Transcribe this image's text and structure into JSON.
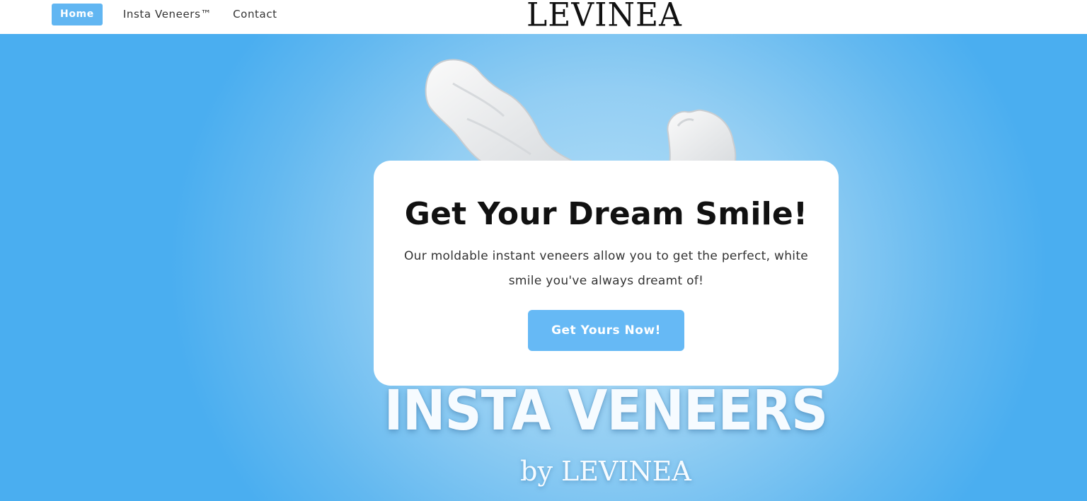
{
  "header": {
    "nav": [
      {
        "label": "Home",
        "active": true
      },
      {
        "label": "Insta Veneers™",
        "active": false
      },
      {
        "label": "Contact",
        "active": false
      }
    ],
    "logo": "LEVINEA"
  },
  "hero": {
    "card": {
      "title": "Get Your Dream Smile!",
      "text": "Our moldable instant veneers allow you to get the perfect, white smile you've always dreamt of!",
      "cta_label": "Get Yours Now!"
    },
    "brand_title": "INSTA VENEERS",
    "brand_subtitle": "by LEVINEA"
  },
  "colors": {
    "accent": "#61b6f2",
    "hero_light": "#b6e0f8",
    "hero_dark": "#4aaef0",
    "card_bg": "#ffffff"
  }
}
